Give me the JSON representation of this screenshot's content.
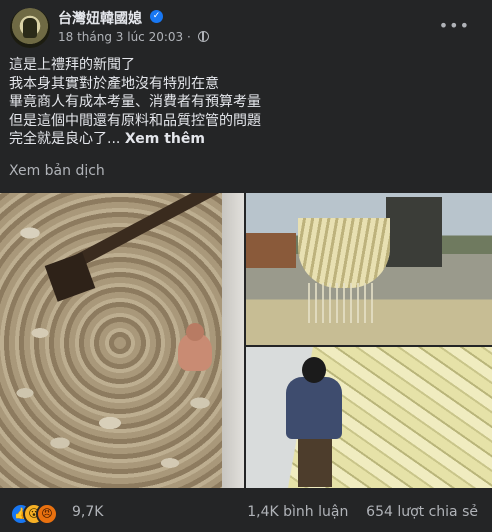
{
  "post": {
    "author": "台灣妞韓國媳",
    "verified_icon": "verified-check-icon",
    "timestamp": "18 tháng 3 lúc 20:03",
    "separator": " · ",
    "audience_icon": "globe-icon",
    "more_icon": "more-options-icon",
    "text_lines": [
      "這是上禮拜的新聞了",
      "我本身其實對於產地沒有特別在意",
      "畢竟商人有成本考量、消費者有預算考量",
      "但是這個中間還有原料和品質控管的問題",
      "完全就是良心了..."
    ],
    "see_more": "Xem thêm",
    "translate": "Xem bản dịch"
  },
  "photos": [
    {
      "desc": "excavator-cabbage-pit-worker"
    },
    {
      "desc": "excavator-bucket-cabbage"
    },
    {
      "desc": "man-standing-on-cabbage"
    }
  ],
  "footer": {
    "reactions": [
      "like-icon",
      "wow-icon",
      "angry-icon"
    ],
    "reaction_count": "9,7K",
    "comments": "1,4K bình luận",
    "shares": "654 lượt chia sẻ"
  }
}
